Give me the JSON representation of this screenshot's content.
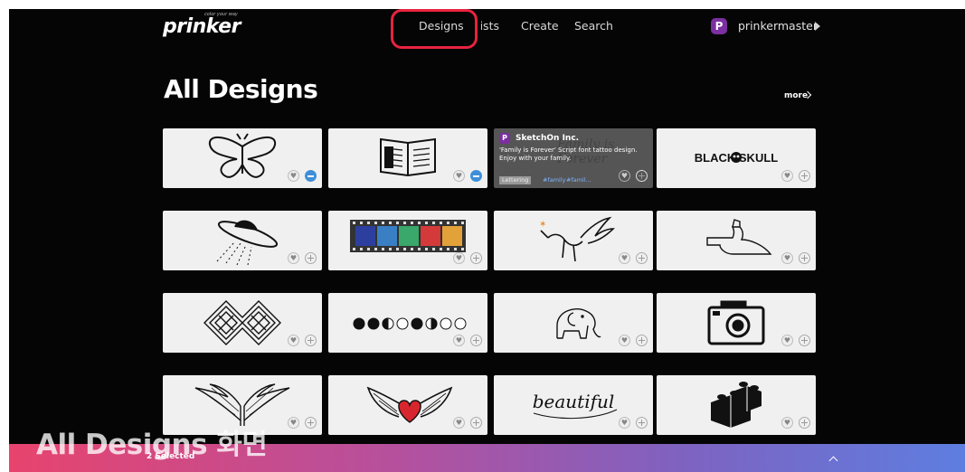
{
  "nav": {
    "logo": "prinker",
    "logo_tagline": "color your way",
    "links": [
      "Designs",
      "Lists",
      "Create",
      "Search"
    ],
    "highlighted_link": "Designs"
  },
  "user": {
    "avatar_letter": "P",
    "name": "prinkermaster"
  },
  "page": {
    "title": "All Designs",
    "more_label": "more"
  },
  "cards": [
    {
      "name": "butterfly",
      "action": "remove"
    },
    {
      "name": "open-book",
      "action": "remove"
    },
    {
      "name": "family-is-forever",
      "action": "add"
    },
    {
      "name": "black-skull",
      "action": "add"
    },
    {
      "name": "ufo",
      "action": "add"
    },
    {
      "name": "color-film",
      "action": "add"
    },
    {
      "name": "unicorn",
      "action": "add"
    },
    {
      "name": "hand-gun",
      "action": "add"
    },
    {
      "name": "celtic-knot",
      "action": "add"
    },
    {
      "name": "moon-phases",
      "action": "add"
    },
    {
      "name": "elephant",
      "action": "add"
    },
    {
      "name": "camera",
      "action": "add"
    },
    {
      "name": "wings",
      "action": "add"
    },
    {
      "name": "winged-heart",
      "action": "add"
    },
    {
      "name": "beautiful",
      "action": "add"
    },
    {
      "name": "blocks",
      "action": "add"
    }
  ],
  "hover_card": {
    "avatar_letter": "P",
    "author": "SketchOn Inc.",
    "description": "'Family is Forever' Script font tattoo design. Enjoy with your family.",
    "category": "Lettering",
    "tags": [
      "#family",
      "#famil..."
    ],
    "script_text": "Family is Forever"
  },
  "card_texts": {
    "skull_logo": "BLACK SKULL",
    "beautiful_text": "beautiful"
  },
  "bottom_bar": {
    "selected_label": "2 Selected"
  },
  "overlay_caption": "All Designs 화면",
  "colors": {
    "highlight_border": "#e8233f",
    "remove_button": "#3f8fd8",
    "avatar": "#7b2fa0",
    "bar_start": "#e7446e",
    "bar_end": "#5d7ee0"
  }
}
